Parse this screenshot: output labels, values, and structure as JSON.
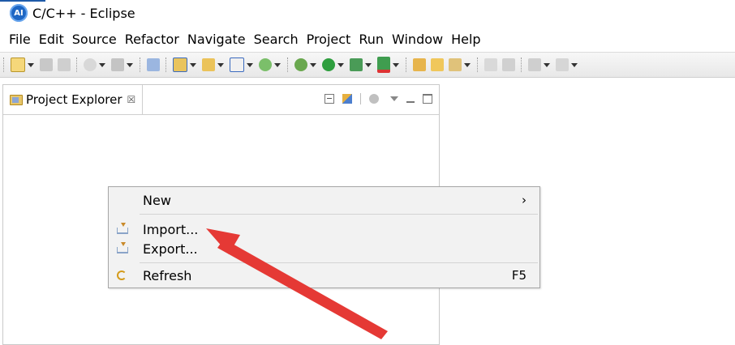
{
  "window": {
    "icon_text": "AI",
    "title": "C/C++ - Eclipse",
    "accent_color": "#1e5aa8"
  },
  "menubar": {
    "items": [
      "File",
      "Edit",
      "Source",
      "Refactor",
      "Navigate",
      "Search",
      "Project",
      "Run",
      "Window",
      "Help"
    ]
  },
  "toolbar": {
    "icons": [
      "new-wizard-icon",
      "save-icon",
      "save-all-icon",
      "build-icon",
      "build-config-icon",
      "toggle-mark-icon",
      "new-cpp-project-icon",
      "new-folder-icon",
      "new-source-file-icon",
      "new-class-icon",
      "debug-icon",
      "run-icon",
      "run-external-icon",
      "coverage-icon",
      "open-type-icon",
      "open-folder-icon",
      "search-icon",
      "view-icon",
      "next-annotation-icon",
      "back-icon"
    ]
  },
  "project_explorer": {
    "tab_label": "Project Explorer",
    "close_glyph": "☒"
  },
  "context_menu": {
    "items": [
      {
        "label": "New",
        "submenu_glyph": "›"
      },
      {
        "label": "Import..."
      },
      {
        "label": "Export..."
      },
      {
        "label": "Refresh",
        "shortcut": "F5"
      }
    ]
  },
  "annotation": {
    "arrow_color": "#e53935"
  }
}
